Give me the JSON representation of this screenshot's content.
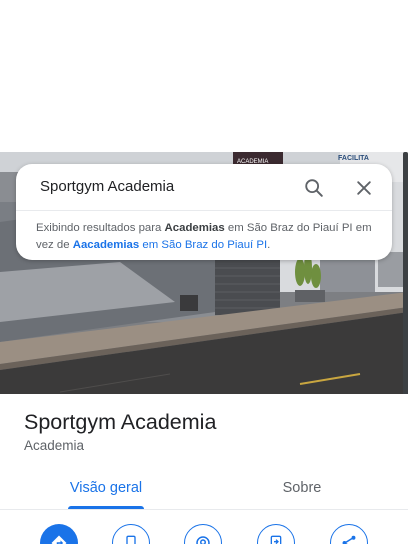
{
  "search": {
    "query": "Sportgym Academia"
  },
  "suggestion": {
    "prefix": "Exibindo resultados para ",
    "shown_term": "Academias",
    "shown_location": " em São Braz do Piauí PI em vez de ",
    "original_term": "Aacademias",
    "original_location": " em São Braz do Piauí PI",
    "suffix": "."
  },
  "photo": {
    "sign_text": "FACILITA",
    "banner_text": "ACADEMIA"
  },
  "place": {
    "name": "Sportgym Academia",
    "category": "Academia"
  },
  "tabs": [
    {
      "label": "Visão geral",
      "active": true
    },
    {
      "label": "Sobre",
      "active": false
    }
  ],
  "actions": [
    {
      "icon": "directions-icon",
      "style": "primary"
    },
    {
      "icon": "phone-icon",
      "style": "outline"
    },
    {
      "icon": "nearby-icon",
      "style": "outline"
    },
    {
      "icon": "save-to-phone-icon",
      "style": "outline"
    },
    {
      "icon": "share-icon",
      "style": "outline"
    }
  ],
  "colors": {
    "accent": "#1a73e8",
    "text_primary": "#202124",
    "text_secondary": "#5f6368"
  }
}
